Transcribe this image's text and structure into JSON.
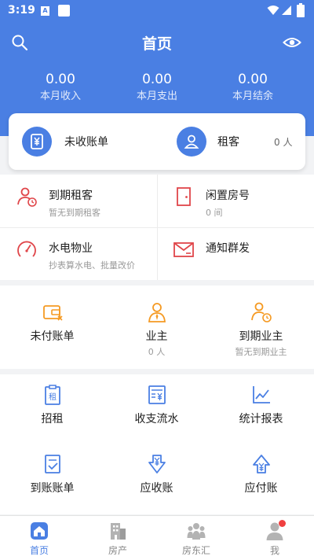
{
  "status_bar": {
    "time": "3:19",
    "badge": "A"
  },
  "header": {
    "title": "首页",
    "stats": [
      {
        "value": "0.00",
        "label": "本月收入"
      },
      {
        "value": "0.00",
        "label": "本月支出"
      },
      {
        "value": "0.00",
        "label": "本月结余"
      }
    ]
  },
  "summary_card": {
    "unpaid_bills": {
      "label": "未收账单"
    },
    "tenants": {
      "label": "租客",
      "count": "0 人"
    }
  },
  "section_alerts": [
    {
      "title": "到期租客",
      "subtitle": "暂无到期租客",
      "icon": "tenant-clock-icon"
    },
    {
      "title": "闲置房号",
      "subtitle": "0 间",
      "icon": "door-icon"
    },
    {
      "title": "水电物业",
      "subtitle": "抄表算水电、批量改价",
      "icon": "gauge-icon"
    },
    {
      "title": "通知群发",
      "subtitle": "",
      "icon": "mail-icon"
    }
  ],
  "section_owner": [
    {
      "label": "未付账单",
      "sub": "",
      "icon": "wallet-icon"
    },
    {
      "label": "业主",
      "sub": "0 人",
      "icon": "owner-icon"
    },
    {
      "label": "到期业主",
      "sub": "暂无到期业主",
      "icon": "owner-clock-icon"
    }
  ],
  "section_tools": [
    {
      "label": "招租",
      "icon": "rent-doc-icon"
    },
    {
      "label": "收支流水",
      "icon": "ledger-icon"
    },
    {
      "label": "统计报表",
      "icon": "chart-icon"
    },
    {
      "label": "到账账单",
      "icon": "checked-doc-icon"
    },
    {
      "label": "应收账",
      "icon": "receivable-icon"
    },
    {
      "label": "应付账",
      "icon": "payable-icon"
    }
  ],
  "bottom_nav": [
    {
      "label": "首页",
      "icon": "home-icon",
      "active": true
    },
    {
      "label": "房产",
      "icon": "building-icon",
      "active": false
    },
    {
      "label": "房东汇",
      "icon": "community-icon",
      "active": false
    },
    {
      "label": "我",
      "icon": "profile-icon",
      "active": false
    }
  ],
  "colors": {
    "primary": "#4a7fe3",
    "red": "#e0464a",
    "orange": "#f59a23",
    "background": "#f2f3f5"
  }
}
